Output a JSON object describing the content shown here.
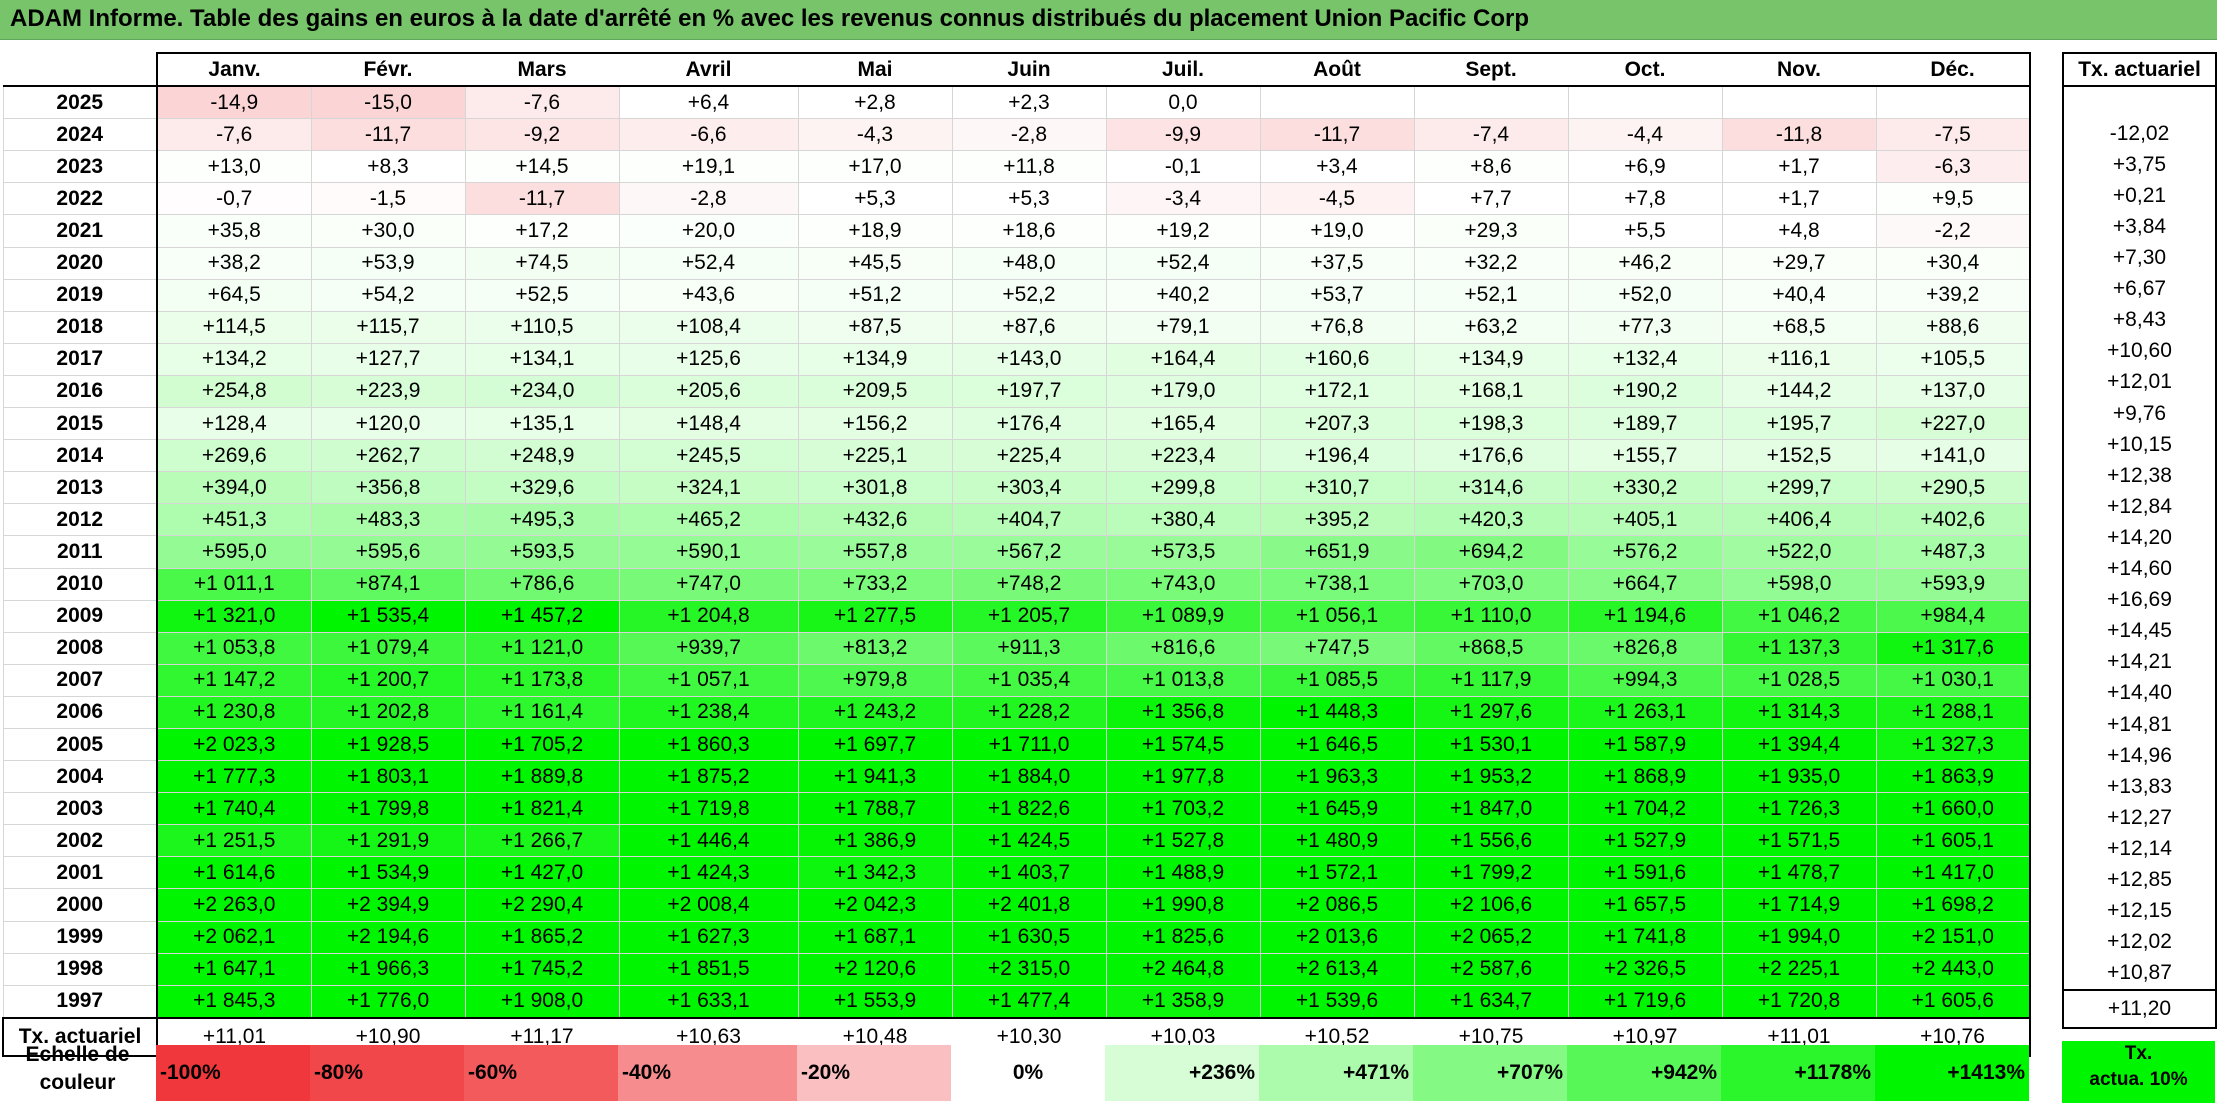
{
  "title": "ADAM Informe. Table des gains en euros à la date d'arrêté en % avec les revenus connus distribués du placement Union Pacific Corp",
  "months": [
    "Janv.",
    "Févr.",
    "Mars",
    "Avril",
    "Mai",
    "Juin",
    "Juil.",
    "Août",
    "Sept.",
    "Oct.",
    "Nov.",
    "Déc."
  ],
  "ta_header": "Tx. actuariel",
  "rows": [
    {
      "year": "2025",
      "v": [
        "-14,9",
        "-15,0",
        "-7,6",
        "+6,4",
        "+2,8",
        "+2,3",
        "0,0",
        "",
        "",
        "",
        "",
        ""
      ],
      "ta": ""
    },
    {
      "year": "2024",
      "v": [
        "-7,6",
        "-11,7",
        "-9,2",
        "-6,6",
        "-4,3",
        "-2,8",
        "-9,9",
        "-11,7",
        "-7,4",
        "-4,4",
        "-11,8",
        "-7,5"
      ],
      "ta": "-12,02"
    },
    {
      "year": "2023",
      "v": [
        "+13,0",
        "+8,3",
        "+14,5",
        "+19,1",
        "+17,0",
        "+11,8",
        "-0,1",
        "+3,4",
        "+8,6",
        "+6,9",
        "+1,7",
        "-6,3"
      ],
      "ta": "+3,75"
    },
    {
      "year": "2022",
      "v": [
        "-0,7",
        "-1,5",
        "-11,7",
        "-2,8",
        "+5,3",
        "+5,3",
        "-3,4",
        "-4,5",
        "+7,7",
        "+7,8",
        "+1,7",
        "+9,5"
      ],
      "ta": "+0,21"
    },
    {
      "year": "2021",
      "v": [
        "+35,8",
        "+30,0",
        "+17,2",
        "+20,0",
        "+18,9",
        "+18,6",
        "+19,2",
        "+19,0",
        "+29,3",
        "+5,5",
        "+4,8",
        "-2,2"
      ],
      "ta": "+3,84"
    },
    {
      "year": "2020",
      "v": [
        "+38,2",
        "+53,9",
        "+74,5",
        "+52,4",
        "+45,5",
        "+48,0",
        "+52,4",
        "+37,5",
        "+32,2",
        "+46,2",
        "+29,7",
        "+30,4"
      ],
      "ta": "+7,30"
    },
    {
      "year": "2019",
      "v": [
        "+64,5",
        "+54,2",
        "+52,5",
        "+43,6",
        "+51,2",
        "+52,2",
        "+40,2",
        "+53,7",
        "+52,1",
        "+52,0",
        "+40,4",
        "+39,2"
      ],
      "ta": "+6,67"
    },
    {
      "year": "2018",
      "v": [
        "+114,5",
        "+115,7",
        "+110,5",
        "+108,4",
        "+87,5",
        "+87,6",
        "+79,1",
        "+76,8",
        "+63,2",
        "+77,3",
        "+68,5",
        "+88,6"
      ],
      "ta": "+8,43"
    },
    {
      "year": "2017",
      "v": [
        "+134,2",
        "+127,7",
        "+134,1",
        "+125,6",
        "+134,9",
        "+143,0",
        "+164,4",
        "+160,6",
        "+134,9",
        "+132,4",
        "+116,1",
        "+105,5"
      ],
      "ta": "+10,60"
    },
    {
      "year": "2016",
      "v": [
        "+254,8",
        "+223,9",
        "+234,0",
        "+205,6",
        "+209,5",
        "+197,7",
        "+179,0",
        "+172,1",
        "+168,1",
        "+190,2",
        "+144,2",
        "+137,0"
      ],
      "ta": "+12,01"
    },
    {
      "year": "2015",
      "v": [
        "+128,4",
        "+120,0",
        "+135,1",
        "+148,4",
        "+156,2",
        "+176,4",
        "+165,4",
        "+207,3",
        "+198,3",
        "+189,7",
        "+195,7",
        "+227,0"
      ],
      "ta": "+9,76"
    },
    {
      "year": "2014",
      "v": [
        "+269,6",
        "+262,7",
        "+248,9",
        "+245,5",
        "+225,1",
        "+225,4",
        "+223,4",
        "+196,4",
        "+176,6",
        "+155,7",
        "+152,5",
        "+141,0"
      ],
      "ta": "+10,15"
    },
    {
      "year": "2013",
      "v": [
        "+394,0",
        "+356,8",
        "+329,6",
        "+324,1",
        "+301,8",
        "+303,4",
        "+299,8",
        "+310,7",
        "+314,6",
        "+330,2",
        "+299,7",
        "+290,5"
      ],
      "ta": "+12,38"
    },
    {
      "year": "2012",
      "v": [
        "+451,3",
        "+483,3",
        "+495,3",
        "+465,2",
        "+432,6",
        "+404,7",
        "+380,4",
        "+395,2",
        "+420,3",
        "+405,1",
        "+406,4",
        "+402,6"
      ],
      "ta": "+12,84"
    },
    {
      "year": "2011",
      "v": [
        "+595,0",
        "+595,6",
        "+593,5",
        "+590,1",
        "+557,8",
        "+567,2",
        "+573,5",
        "+651,9",
        "+694,2",
        "+576,2",
        "+522,0",
        "+487,3"
      ],
      "ta": "+14,20"
    },
    {
      "year": "2010",
      "v": [
        "+1 011,1",
        "+874,1",
        "+786,6",
        "+747,0",
        "+733,2",
        "+748,2",
        "+743,0",
        "+738,1",
        "+703,0",
        "+664,7",
        "+598,0",
        "+593,9"
      ],
      "ta": "+14,60"
    },
    {
      "year": "2009",
      "v": [
        "+1 321,0",
        "+1 535,4",
        "+1 457,2",
        "+1 204,8",
        "+1 277,5",
        "+1 205,7",
        "+1 089,9",
        "+1 056,1",
        "+1 110,0",
        "+1 194,6",
        "+1 046,2",
        "+984,4"
      ],
      "ta": "+16,69"
    },
    {
      "year": "2008",
      "v": [
        "+1 053,8",
        "+1 079,4",
        "+1 121,0",
        "+939,7",
        "+813,2",
        "+911,3",
        "+816,6",
        "+747,5",
        "+868,5",
        "+826,8",
        "+1 137,3",
        "+1 317,6"
      ],
      "ta": "+14,45"
    },
    {
      "year": "2007",
      "v": [
        "+1 147,2",
        "+1 200,7",
        "+1 173,8",
        "+1 057,1",
        "+979,8",
        "+1 035,4",
        "+1 013,8",
        "+1 085,5",
        "+1 117,9",
        "+994,3",
        "+1 028,5",
        "+1 030,1"
      ],
      "ta": "+14,21"
    },
    {
      "year": "2006",
      "v": [
        "+1 230,8",
        "+1 202,8",
        "+1 161,4",
        "+1 238,4",
        "+1 243,2",
        "+1 228,2",
        "+1 356,8",
        "+1 448,3",
        "+1 297,6",
        "+1 263,1",
        "+1 314,3",
        "+1 288,1"
      ],
      "ta": "+14,40"
    },
    {
      "year": "2005",
      "v": [
        "+2 023,3",
        "+1 928,5",
        "+1 705,2",
        "+1 860,3",
        "+1 697,7",
        "+1 711,0",
        "+1 574,5",
        "+1 646,5",
        "+1 530,1",
        "+1 587,9",
        "+1 394,4",
        "+1 327,3"
      ],
      "ta": "+14,81"
    },
    {
      "year": "2004",
      "v": [
        "+1 777,3",
        "+1 803,1",
        "+1 889,8",
        "+1 875,2",
        "+1 941,3",
        "+1 884,0",
        "+1 977,8",
        "+1 963,3",
        "+1 953,2",
        "+1 868,9",
        "+1 935,0",
        "+1 863,9"
      ],
      "ta": "+14,96"
    },
    {
      "year": "2003",
      "v": [
        "+1 740,4",
        "+1 799,8",
        "+1 821,4",
        "+1 719,8",
        "+1 788,7",
        "+1 822,6",
        "+1 703,2",
        "+1 645,9",
        "+1 847,0",
        "+1 704,2",
        "+1 726,3",
        "+1 660,0"
      ],
      "ta": "+13,83"
    },
    {
      "year": "2002",
      "v": [
        "+1 251,5",
        "+1 291,9",
        "+1 266,7",
        "+1 446,4",
        "+1 386,9",
        "+1 424,5",
        "+1 527,8",
        "+1 480,9",
        "+1 556,6",
        "+1 527,9",
        "+1 571,5",
        "+1 605,1"
      ],
      "ta": "+12,27"
    },
    {
      "year": "2001",
      "v": [
        "+1 614,6",
        "+1 534,9",
        "+1 427,0",
        "+1 424,3",
        "+1 342,3",
        "+1 403,7",
        "+1 488,9",
        "+1 572,1",
        "+1 799,2",
        "+1 591,6",
        "+1 478,7",
        "+1 417,0"
      ],
      "ta": "+12,14"
    },
    {
      "year": "2000",
      "v": [
        "+2 263,0",
        "+2 394,9",
        "+2 290,4",
        "+2 008,4",
        "+2 042,3",
        "+2 401,8",
        "+1 990,8",
        "+2 086,5",
        "+2 106,6",
        "+1 657,5",
        "+1 714,9",
        "+1 698,2"
      ],
      "ta": "+12,85"
    },
    {
      "year": "1999",
      "v": [
        "+2 062,1",
        "+2 194,6",
        "+1 865,2",
        "+1 627,3",
        "+1 687,1",
        "+1 630,5",
        "+1 825,6",
        "+2 013,6",
        "+2 065,2",
        "+1 741,8",
        "+1 994,0",
        "+2 151,0"
      ],
      "ta": "+12,15"
    },
    {
      "year": "1998",
      "v": [
        "+1 647,1",
        "+1 966,3",
        "+1 745,2",
        "+1 851,5",
        "+2 120,6",
        "+2 315,0",
        "+2 464,8",
        "+2 613,4",
        "+2 587,6",
        "+2 326,5",
        "+2 225,1",
        "+2 443,0"
      ],
      "ta": "+12,02"
    },
    {
      "year": "1997",
      "v": [
        "+1 845,3",
        "+1 776,0",
        "+1 908,0",
        "+1 633,1",
        "+1 553,9",
        "+1 477,4",
        "+1 358,9",
        "+1 539,6",
        "+1 634,7",
        "+1 719,6",
        "+1 720,8",
        "+1 605,6"
      ],
      "ta": "+10,87"
    }
  ],
  "footer": {
    "label": "Tx. actuariel",
    "values": [
      "+11,01",
      "+10,90",
      "+11,17",
      "+10,63",
      "+10,48",
      "+10,30",
      "+10,03",
      "+10,52",
      "+10,75",
      "+10,97",
      "+11,01",
      "+10,76"
    ],
    "ta": "+11,20"
  },
  "scale": {
    "label_line1": "Echelle de",
    "label_line2": "couleur",
    "items": [
      {
        "text": "-100%",
        "color": "#f0383c",
        "align": "left"
      },
      {
        "text": "-80%",
        "color": "#f1464a",
        "align": "left"
      },
      {
        "text": "-60%",
        "color": "#f35a5c",
        "align": "left"
      },
      {
        "text": "-40%",
        "color": "#f68c8e",
        "align": "left"
      },
      {
        "text": "-20%",
        "color": "#fabfc0",
        "align": "left"
      },
      {
        "text": "0%",
        "color": "#ffffff",
        "align": "center"
      },
      {
        "text": "+236%",
        "color": "#d6fdd6",
        "align": "right"
      },
      {
        "text": "+471%",
        "color": "#acfbac",
        "align": "right"
      },
      {
        "text": "+707%",
        "color": "#84f984",
        "align": "right"
      },
      {
        "text": "+942%",
        "color": "#57f757",
        "align": "right"
      },
      {
        "text": "+1178%",
        "color": "#2bf62b",
        "align": "right"
      },
      {
        "text": "+1413%",
        "color": "#00f500",
        "align": "right"
      }
    ],
    "ta_line1": "Tx.",
    "ta_line2": "actua. 10%"
  }
}
